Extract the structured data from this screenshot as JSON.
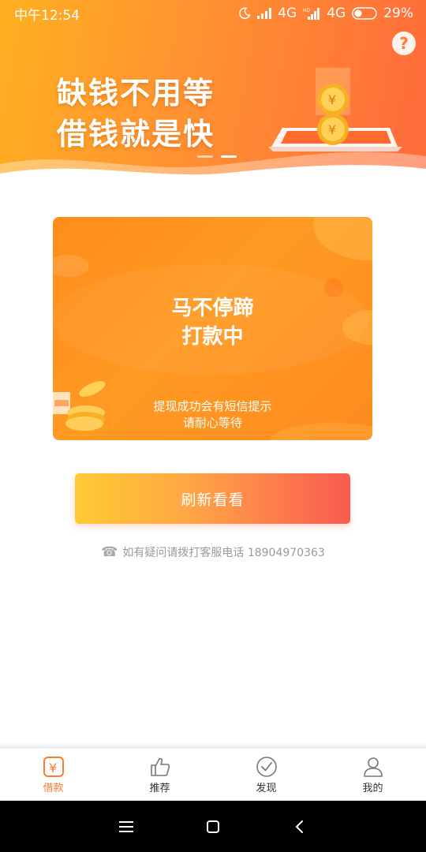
{
  "status_bar": {
    "time": "中午12:54",
    "network_1": "4G",
    "network_2": "4G",
    "battery": "29%"
  },
  "banner": {
    "slogan_line1": "缺钱不用等",
    "slogan_line2": "借钱就是快",
    "help_icon": "question-icon",
    "pager_count": 2,
    "pager_active": 1
  },
  "status_card": {
    "title_line1": "马不停蹄",
    "title_line2": "打款中",
    "subtitle_line1": "提现成功会有短信提示",
    "subtitle_line2": "请耐心等待"
  },
  "refresh_button": {
    "label": "刷新看看"
  },
  "hotline": {
    "icon": "telephone-icon",
    "text": "如有疑问请拨打客服电话 18904970363"
  },
  "tabbar": {
    "items": [
      {
        "label": "借款",
        "icon": "yuan-icon",
        "active": true
      },
      {
        "label": "推荐",
        "icon": "thumbs-up-icon",
        "active": false
      },
      {
        "label": "发现",
        "icon": "check-circle-icon",
        "active": false
      },
      {
        "label": "我的",
        "icon": "user-icon",
        "active": false
      }
    ]
  },
  "colors": {
    "accent": "#ff7a2c",
    "banner_start": "#ffb020",
    "banner_end": "#ff6a3a",
    "button_start": "#ffcb33",
    "button_end": "#fa5a52",
    "muted_text": "#9a9a9a"
  }
}
